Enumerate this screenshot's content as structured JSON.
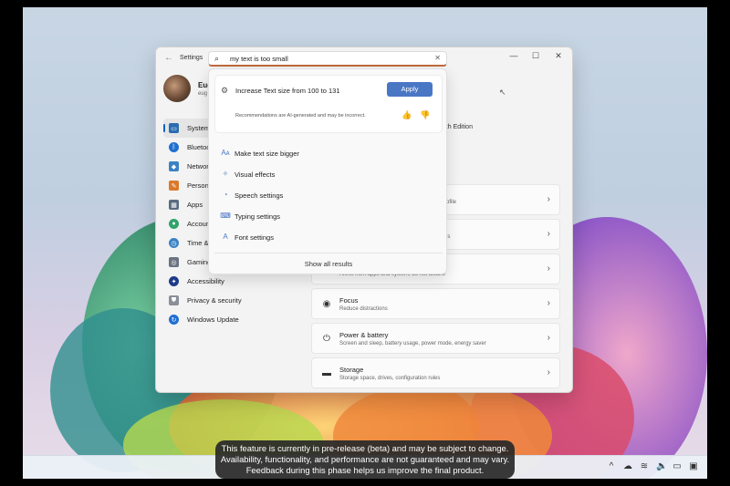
{
  "window": {
    "app_title": "Settings",
    "controls": {
      "minimize": "—",
      "maximize": "☐",
      "close": "✕"
    }
  },
  "profile": {
    "name": "Eug",
    "email": "eug"
  },
  "nav": {
    "items": [
      {
        "label": "System",
        "icon": "monitor-icon",
        "color": "#2b6cb0",
        "active": true
      },
      {
        "label": "Bluetoo",
        "icon": "bluetooth-icon",
        "color": "#1f6fd1"
      },
      {
        "label": "Network",
        "icon": "wifi-icon",
        "color": "#3b82c4"
      },
      {
        "label": "Persona",
        "icon": "brush-icon",
        "color": "#d97a2b"
      },
      {
        "label": "Apps",
        "icon": "apps-icon",
        "color": "#5a6b80"
      },
      {
        "label": "Account",
        "icon": "person-icon",
        "color": "#2fa36b"
      },
      {
        "label": "Time &",
        "icon": "clock-icon",
        "color": "#3b82c4"
      },
      {
        "label": "Gaming",
        "icon": "gamepad-icon",
        "color": "#6b7280"
      },
      {
        "label": "Accessibility",
        "icon": "accessibility-icon",
        "color": "#1e3a8a"
      },
      {
        "label": "Privacy & security",
        "icon": "shield-icon",
        "color": "#8a8f98"
      },
      {
        "label": "Windows Update",
        "icon": "update-icon",
        "color": "#1f6fd1"
      }
    ]
  },
  "main": {
    "device_line": ", 7th Edition",
    "partial_rows": [
      {
        "text": "rofile"
      },
      {
        "text": "es"
      },
      {
        "text": "Alerts from apps and system, do not disturb"
      }
    ],
    "cards": [
      {
        "title": "Focus",
        "sub": "Reduce distractions",
        "icon": "focus-icon"
      },
      {
        "title": "Power & battery",
        "sub": "Screen and sleep, battery usage, power mode, energy saver",
        "icon": "power-icon"
      },
      {
        "title": "Storage",
        "sub": "Storage space, drives, configuration rules",
        "icon": "storage-icon"
      }
    ]
  },
  "search": {
    "query": "my text is too small",
    "recommendation": {
      "title": "Increase Text size from 100 to 131",
      "apply_label": "Apply",
      "note": "Recommendations are AI-generated and may be incorrect."
    },
    "results": [
      {
        "label": "Make text size bigger",
        "icon": "text-size-icon"
      },
      {
        "label": "Visual effects",
        "icon": "visual-effects-icon"
      },
      {
        "label": "Speech settings",
        "icon": "speech-icon"
      },
      {
        "label": "Typing settings",
        "icon": "keyboard-icon"
      },
      {
        "label": "Font settings",
        "icon": "font-icon"
      }
    ],
    "show_all": "Show all results"
  },
  "caption": {
    "line1": "This feature is currently in pre-release (beta) and may be subject to change.",
    "line2": "Availability, functionality, and performance are not guaranteed and may vary.",
    "line3": "Feedback during this phase helps us improve the final product."
  }
}
